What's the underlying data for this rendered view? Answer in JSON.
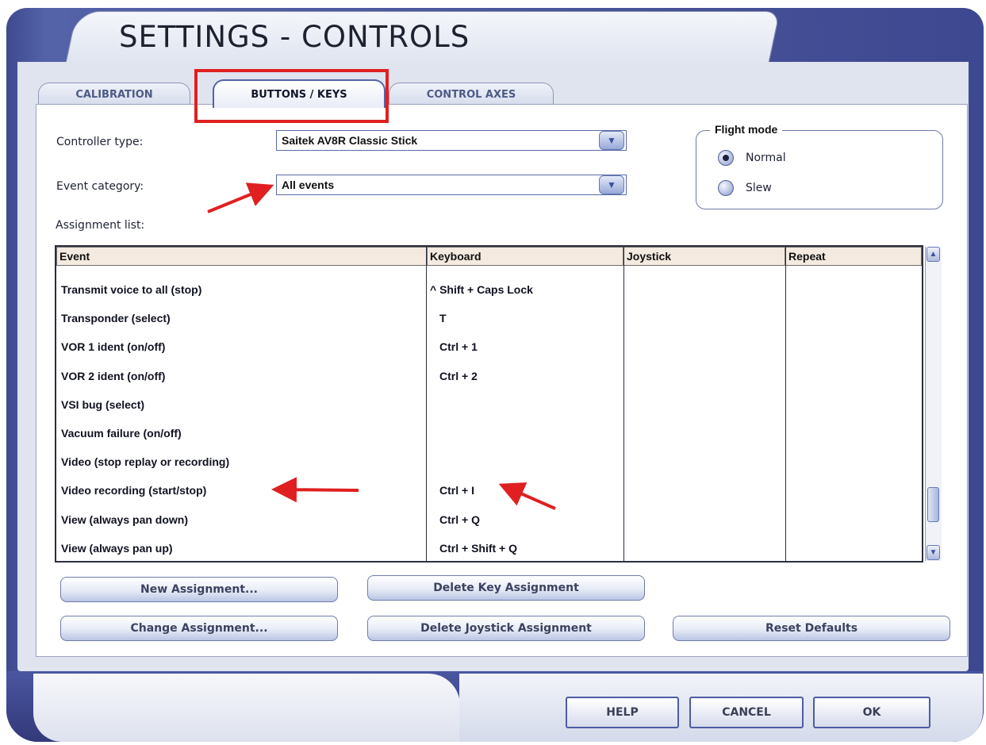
{
  "window": {
    "title": "SETTINGS - CONTROLS"
  },
  "tabs": [
    {
      "label": "CALIBRATION",
      "active": false
    },
    {
      "label": "BUTTONS / KEYS",
      "active": true
    },
    {
      "label": "CONTROL AXES",
      "active": false
    }
  ],
  "form": {
    "controller_type_label": "Controller type:",
    "controller_type_value": "Saitek AV8R Classic Stick",
    "event_category_label": "Event category:",
    "event_category_value": "All events",
    "assignment_list_label": "Assignment list:"
  },
  "flight_mode": {
    "legend": "Flight mode",
    "options": [
      {
        "label": "Normal",
        "selected": true
      },
      {
        "label": "Slew",
        "selected": false
      }
    ]
  },
  "table": {
    "columns": [
      "Event",
      "Keyboard",
      "Joystick",
      "Repeat"
    ],
    "rows": [
      {
        "event": "Transmit voice to all (stop)",
        "keyboard": "^ Shift + Caps Lock",
        "joystick": "",
        "repeat": ""
      },
      {
        "event": "Transponder (select)",
        "keyboard": "T",
        "joystick": "",
        "repeat": ""
      },
      {
        "event": "VOR 1 ident (on/off)",
        "keyboard": "Ctrl + 1",
        "joystick": "",
        "repeat": ""
      },
      {
        "event": "VOR 2 ident (on/off)",
        "keyboard": "Ctrl + 2",
        "joystick": "",
        "repeat": ""
      },
      {
        "event": "VSI bug (select)",
        "keyboard": "",
        "joystick": "",
        "repeat": ""
      },
      {
        "event": "Vacuum failure (on/off)",
        "keyboard": "",
        "joystick": "",
        "repeat": ""
      },
      {
        "event": "Video (stop replay or recording)",
        "keyboard": "",
        "joystick": "",
        "repeat": ""
      },
      {
        "event": "Video recording (start/stop)",
        "keyboard": "Ctrl + I",
        "joystick": "",
        "repeat": ""
      },
      {
        "event": "View (always pan down)",
        "keyboard": "Ctrl + Q",
        "joystick": "",
        "repeat": ""
      },
      {
        "event": "View (always pan up)",
        "keyboard": "Ctrl + Shift + Q",
        "joystick": "",
        "repeat": ""
      }
    ]
  },
  "actions": {
    "new_assignment": "New Assignment...",
    "delete_key_assignment": "Delete Key Assignment",
    "change_assignment": "Change Assignment...",
    "delete_joystick_assignment": "Delete Joystick Assignment",
    "reset_defaults": "Reset Defaults"
  },
  "footer": {
    "help": "HELP",
    "cancel": "CANCEL",
    "ok": "OK"
  },
  "colors": {
    "frame": "#3f4a8f",
    "annotation": "#e02020",
    "header_cell": "#f4eadf"
  },
  "icons": [
    "dropdown-arrow-icon",
    "scroll-up-icon",
    "scroll-down-icon"
  ]
}
